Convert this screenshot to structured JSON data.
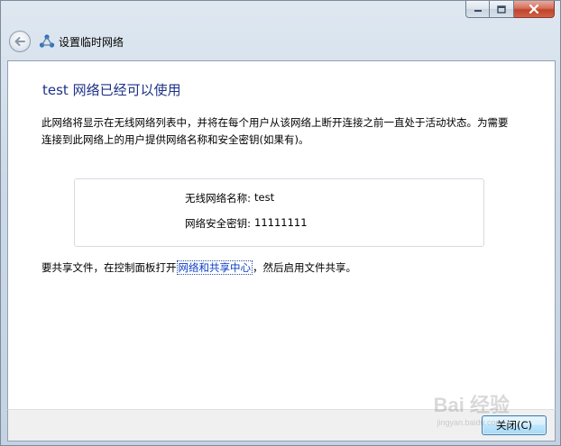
{
  "window": {
    "title": "设置临时网络",
    "controls": {
      "minimize": "minimize-icon",
      "maximize": "maximize-icon",
      "close": "close-icon"
    }
  },
  "main": {
    "instruction": "test 网络已经可以使用",
    "description": "此网络将显示在无线网络列表中，并将在每个用户从该网络上断开连接之前一直处于活动状态。为需要连接到此网络上的用户提供网络名称和安全密钥(如果有)。",
    "info": {
      "name_label": "无线网络名称:",
      "name_value": "test",
      "key_label": "网络安全密钥:",
      "key_value": "11111111"
    },
    "share": {
      "prefix": "要共享文件，在控制面板打开",
      "link": "网络和共享中心",
      "suffix": "，然后启用文件共享。"
    }
  },
  "buttons": {
    "close": "关闭(C)"
  },
  "watermark": {
    "text": "Bai 经验",
    "sub": "jingyan.baidu.com"
  },
  "colors": {
    "accent": "#1e3287",
    "link": "#0a3cc4"
  }
}
